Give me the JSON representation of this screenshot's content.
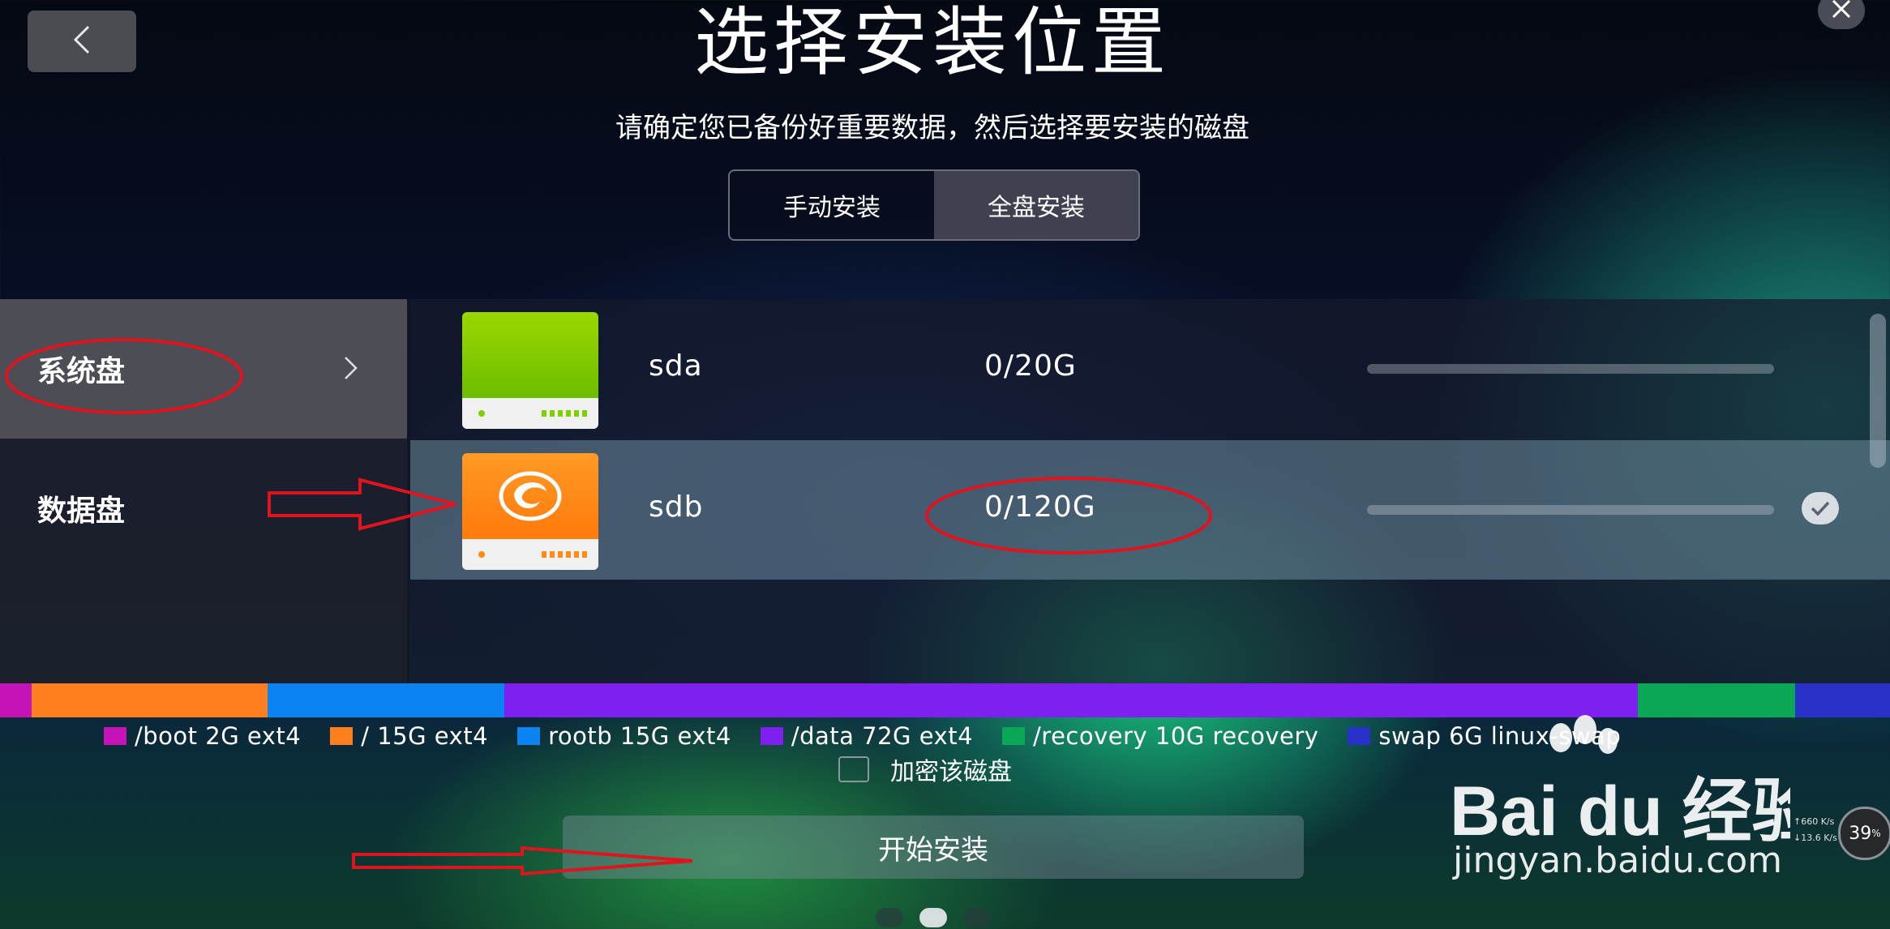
{
  "header": {
    "title": "选择安装位置",
    "subtitle": "请确定您已备份好重要数据，然后选择要安装的磁盘"
  },
  "mode_tabs": [
    {
      "label": "手动安装",
      "active": false
    },
    {
      "label": "全盘安装",
      "active": true
    }
  ],
  "sidebar": {
    "items": [
      {
        "label": "系统盘",
        "active": true
      },
      {
        "label": "数据盘",
        "active": false
      }
    ]
  },
  "disks": [
    {
      "name": "sda",
      "size": "0/20G",
      "color": "#7fce00",
      "selected": false
    },
    {
      "name": "sdb",
      "size": "0/120G",
      "color": "#ff8a14",
      "selected": true
    }
  ],
  "partitions": [
    {
      "label": "/boot 2G ext4",
      "color": "#c414b8",
      "size_gb": 2
    },
    {
      "label": "/ 15G ext4",
      "color": "#ff7e1e",
      "size_gb": 15
    },
    {
      "label": "rootb 15G ext4",
      "color": "#0b84f2",
      "size_gb": 15
    },
    {
      "label": "/data 72G ext4",
      "color": "#7d20f0",
      "size_gb": 72
    },
    {
      "label": "/recovery 10G recovery",
      "color": "#0aa856",
      "size_gb": 10
    },
    {
      "label": "swap 6G linux-swap",
      "color": "#2832c8",
      "size_gb": 6
    }
  ],
  "encrypt": {
    "label": "加密该磁盘",
    "checked": false
  },
  "start_button": {
    "label": "开始安装"
  },
  "pager": {
    "count": 3,
    "active": 1
  },
  "watermark": {
    "brand": "Bai du 经验",
    "url": "jingyan.baidu.com"
  },
  "speed_widget": {
    "upload": "660 K/s",
    "download": "13.6 K/s",
    "percent": "39",
    "percent_unit": "%"
  }
}
